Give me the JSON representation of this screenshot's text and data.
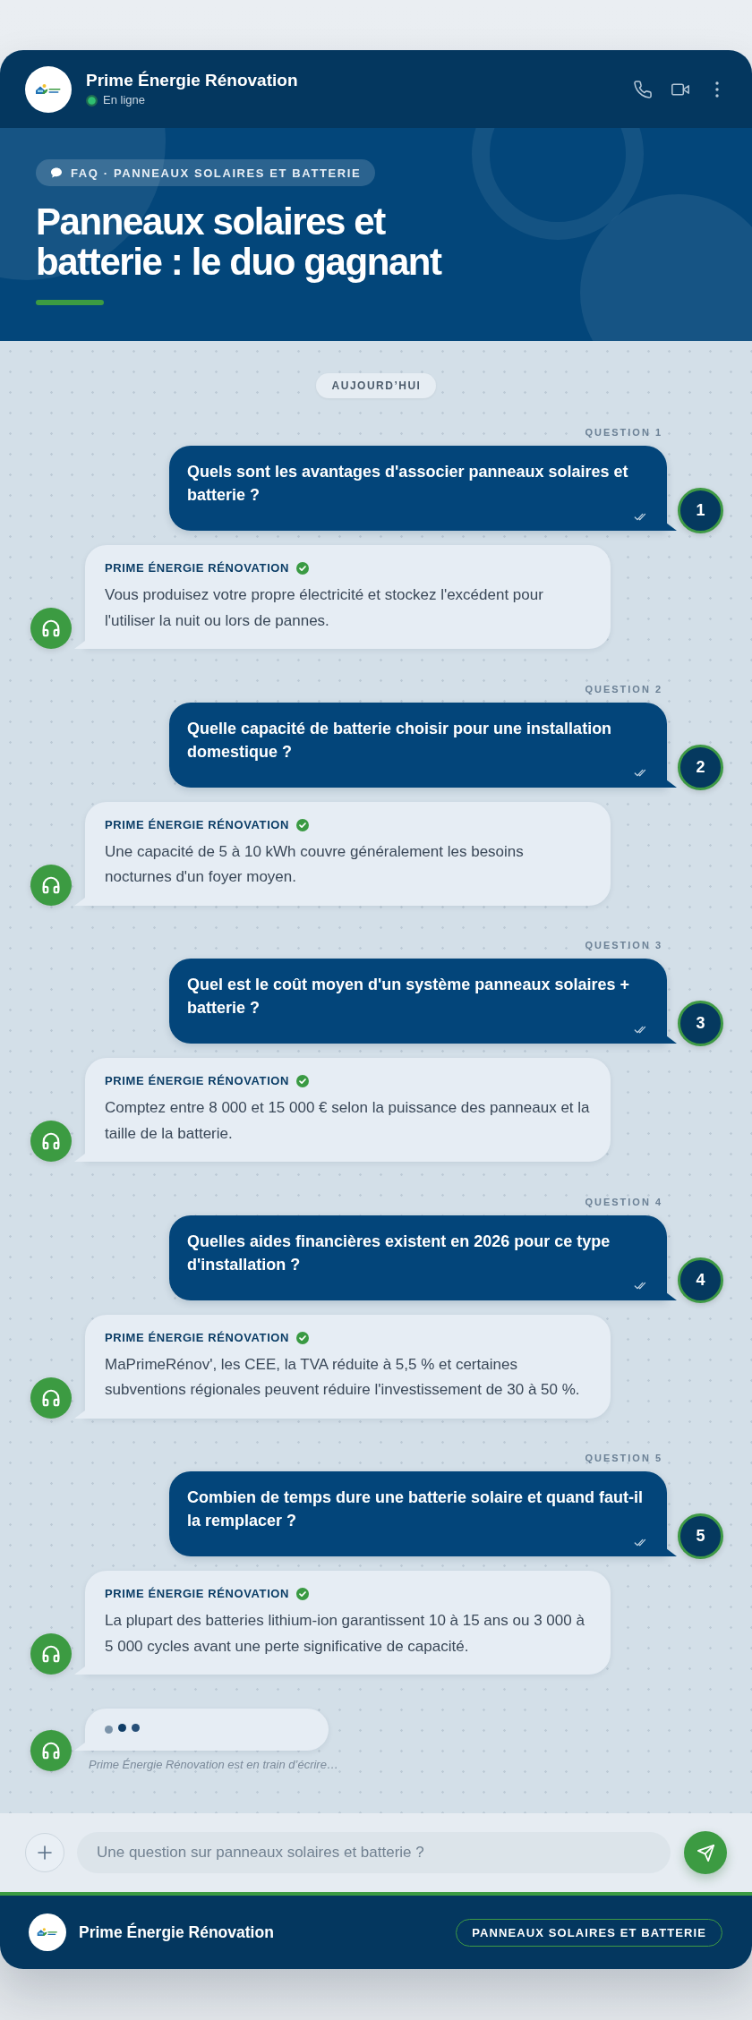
{
  "header": {
    "name": "Prime Énergie Rénovation",
    "status": "En ligne",
    "online": true
  },
  "hero": {
    "tag": "FAQ · PANNEAUX SOLAIRES ET BATTERIE",
    "title": "Panneaux solaires et batterie : le duo gagnant"
  },
  "chat": {
    "date": "AUJOURD’HUI",
    "messages": [
      {
        "label": "QUESTION 1",
        "question": "Quels sont les avantages d'associer panneaux solaires et batterie ?",
        "read": true,
        "number": "1",
        "sender": "PRIME ÉNERGIE RÉNOVATION",
        "verified": true,
        "answer": "Vous produisez votre propre électricité et stockez l'excédent pour l'utiliser la nuit ou lors de pannes."
      },
      {
        "label": "QUESTION 2",
        "question": "Quelle capacité de batterie choisir pour une installation domestique ?",
        "read": true,
        "number": "2",
        "sender": "PRIME ÉNERGIE RÉNOVATION",
        "verified": true,
        "answer": "Une capacité de 5 à 10 kWh couvre généralement les besoins nocturnes d'un foyer moyen."
      },
      {
        "label": "QUESTION 3",
        "question": "Quel est le coût moyen d'un système panneaux solaires + batterie ?",
        "read": true,
        "number": "3",
        "sender": "PRIME ÉNERGIE RÉNOVATION",
        "verified": true,
        "answer": "Comptez entre 8 000 et 15 000 € selon la puissance des panneaux et la taille de la batterie."
      },
      {
        "label": "QUESTION 4",
        "question": "Quelles aides financières existent en 2026 pour ce type d'installation ?",
        "read": true,
        "number": "4",
        "sender": "PRIME ÉNERGIE RÉNOVATION",
        "verified": true,
        "answer": "MaPrimeRénov', les CEE, la TVA réduite à 5,5 % et certaines subventions régionales peuvent réduire l'investissement de 30 à 50 %."
      },
      {
        "label": "QUESTION 5",
        "question": "Combien de temps dure une batterie solaire et quand faut-il la remplacer ?",
        "read": true,
        "number": "5",
        "sender": "PRIME ÉNERGIE RÉNOVATION",
        "verified": true,
        "answer": "La plupart des batteries lithium-ion garantissent 10 à 15 ans ou 3 000 à 5 000 cycles avant une perte significative de capacité."
      }
    ],
    "typing": "Prime Énergie Rénovation est en train d’écrire…"
  },
  "composer": {
    "placeholder": "Une question sur panneaux solaires et batterie ?"
  },
  "footer": {
    "name": "Prime Énergie Rénovation",
    "tag": "PANNEAUX SOLAIRES ET BATTERIE"
  }
}
